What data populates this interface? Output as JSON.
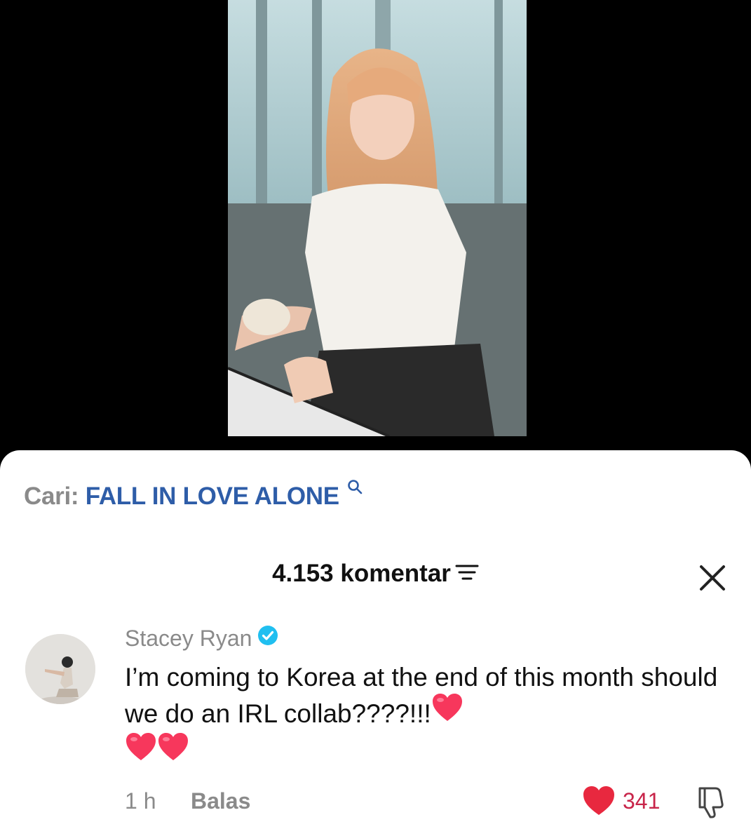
{
  "search": {
    "prefix": "Cari:",
    "query": "FALL IN LOVE ALONE"
  },
  "comments_header": {
    "count_label": "4.153 komentar"
  },
  "comment": {
    "username": "Stacey Ryan",
    "verified": true,
    "text": "I’m coming to Korea at the end of this month should we do an IRL collab????!!!",
    "emoji": [
      "heart-emoji",
      "heart-emoji",
      "heart-emoji"
    ],
    "time": "1 h",
    "reply_label": "Balas",
    "like_count": "341",
    "liked": true
  },
  "colors": {
    "accent_link": "#2e5da8",
    "like_red": "#e8283f",
    "verified_blue": "#20bff0",
    "muted_text": "#8a8a8a"
  }
}
